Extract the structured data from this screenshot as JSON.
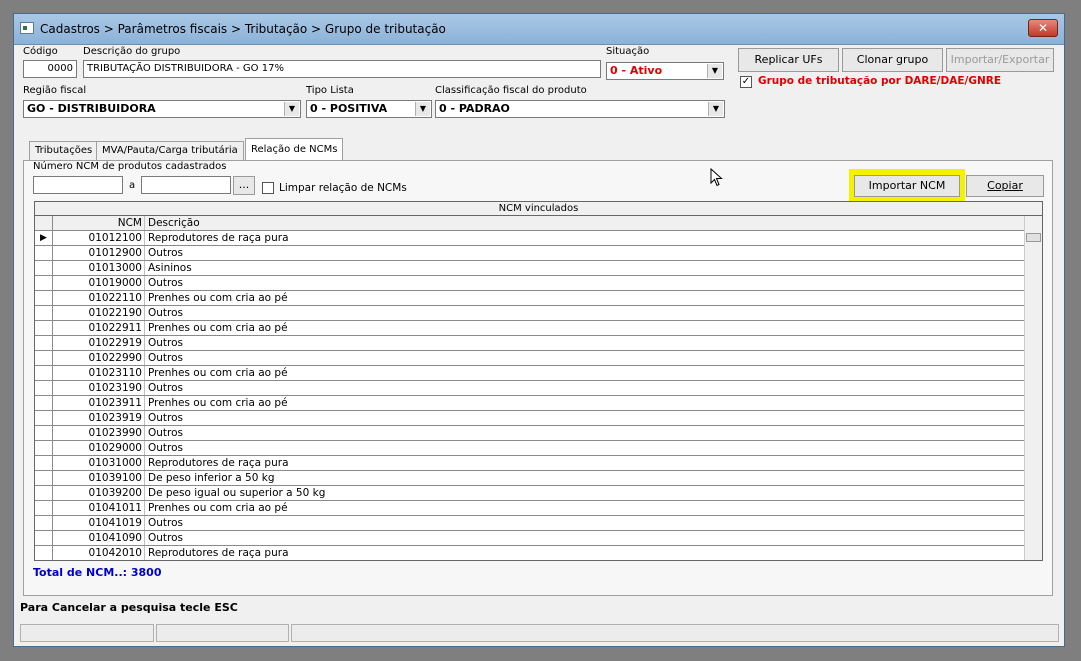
{
  "window": {
    "title": "Cadastros > Parâmetros fiscais > Tributação > Grupo de tributação",
    "close": "✕"
  },
  "form": {
    "codigo_label": "Código",
    "codigo_value": "0000",
    "descricao_label": "Descrição do grupo",
    "descricao_value": "TRIBUTAÇÃO DISTRIBUIDORA - GO 17%",
    "situacao_label": "Situação",
    "situacao_value": "0 - Ativo",
    "regiao_label": "Região fiscal",
    "regiao_value": "GO - DISTRIBUIDORA",
    "tipo_label": "Tipo Lista",
    "tipo_value": "0 - POSITIVA",
    "classificacao_label": "Classificação fiscal do produto",
    "classificacao_value": "0 - PADRAO"
  },
  "buttons": {
    "replicar": "Replicar UFs",
    "clonar": "Clonar grupo",
    "importar_exportar": "Importar/Exportar",
    "importar_ncm": "Importar NCM",
    "copiar": "Copiar",
    "ellipsis": "..."
  },
  "dare": {
    "checked": true,
    "label": "Grupo de tributação por DARE/DAE/GNRE",
    "color": "#e00000"
  },
  "tabs": [
    {
      "label": "Tributações",
      "active": false
    },
    {
      "label": "MVA/Pauta/Carga tributária",
      "active": false
    },
    {
      "label": "Relação de NCMs",
      "active": true
    }
  ],
  "filter": {
    "numero_label": "Número  NCM de produtos cadastrados",
    "from_value": "",
    "a_label": "a",
    "to_value": "",
    "limpar_label": "Limpar relação de NCMs"
  },
  "grid": {
    "title": "NCM vinculados",
    "columns": [
      "NCM",
      "Descrição"
    ],
    "rows": [
      [
        "01012100",
        "Reprodutores de raça pura"
      ],
      [
        "01012900",
        "Outros"
      ],
      [
        "01013000",
        "Asininos"
      ],
      [
        "01019000",
        "Outros"
      ],
      [
        "01022110",
        "Prenhes ou com cria ao pé"
      ],
      [
        "01022190",
        "Outros"
      ],
      [
        "01022911",
        "Prenhes ou com cria ao pé"
      ],
      [
        "01022919",
        "Outros"
      ],
      [
        "01022990",
        "Outros"
      ],
      [
        "01023110",
        "Prenhes ou com cria ao pé"
      ],
      [
        "01023190",
        "Outros"
      ],
      [
        "01023911",
        "Prenhes ou com cria ao pé"
      ],
      [
        "01023919",
        "Outros"
      ],
      [
        "01023990",
        "Outros"
      ],
      [
        "01029000",
        "Outros"
      ],
      [
        "01031000",
        "Reprodutores de raça pura"
      ],
      [
        "01039100",
        "De peso inferior a 50 kg"
      ],
      [
        "01039200",
        "De peso igual ou superior a 50 kg"
      ],
      [
        "01041011",
        "Prenhes ou com cria ao pé"
      ],
      [
        "01041019",
        "Outros"
      ],
      [
        "01041090",
        "Outros"
      ],
      [
        "01042010",
        "Reprodutores de raça pura"
      ]
    ],
    "selected_index": 0
  },
  "total": {
    "label": "Total de NCM..: 3800",
    "color": "#0000cc"
  },
  "status": {
    "text": "Para Cancelar a pesquisa tecle ESC"
  },
  "colors": {
    "highlight": "#f5f200",
    "situacao": "#e00000"
  }
}
